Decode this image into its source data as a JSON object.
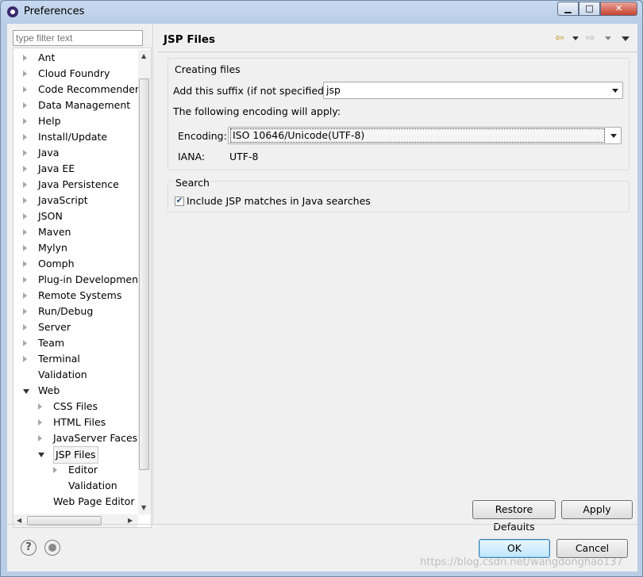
{
  "window": {
    "title": "Preferences",
    "min_symbol": "▁",
    "max_symbol": "□",
    "close_symbol": "✕"
  },
  "filter": {
    "placeholder": "type filter text"
  },
  "tree": [
    {
      "label": "Ant",
      "depth": 0,
      "state": "closed"
    },
    {
      "label": "Cloud Foundry",
      "depth": 0,
      "state": "closed"
    },
    {
      "label": "Code Recommenders",
      "depth": 0,
      "state": "closed"
    },
    {
      "label": "Data Management",
      "depth": 0,
      "state": "closed"
    },
    {
      "label": "Help",
      "depth": 0,
      "state": "closed"
    },
    {
      "label": "Install/Update",
      "depth": 0,
      "state": "closed"
    },
    {
      "label": "Java",
      "depth": 0,
      "state": "closed"
    },
    {
      "label": "Java EE",
      "depth": 0,
      "state": "closed"
    },
    {
      "label": "Java Persistence",
      "depth": 0,
      "state": "closed"
    },
    {
      "label": "JavaScript",
      "depth": 0,
      "state": "closed"
    },
    {
      "label": "JSON",
      "depth": 0,
      "state": "closed"
    },
    {
      "label": "Maven",
      "depth": 0,
      "state": "closed"
    },
    {
      "label": "Mylyn",
      "depth": 0,
      "state": "closed"
    },
    {
      "label": "Oomph",
      "depth": 0,
      "state": "closed"
    },
    {
      "label": "Plug-in Development",
      "depth": 0,
      "state": "closed"
    },
    {
      "label": "Remote Systems",
      "depth": 0,
      "state": "closed"
    },
    {
      "label": "Run/Debug",
      "depth": 0,
      "state": "closed"
    },
    {
      "label": "Server",
      "depth": 0,
      "state": "closed"
    },
    {
      "label": "Team",
      "depth": 0,
      "state": "closed"
    },
    {
      "label": "Terminal",
      "depth": 0,
      "state": "closed"
    },
    {
      "label": "Validation",
      "depth": 0,
      "state": "leaf"
    },
    {
      "label": "Web",
      "depth": 0,
      "state": "open"
    },
    {
      "label": "CSS Files",
      "depth": 1,
      "state": "closed"
    },
    {
      "label": "HTML Files",
      "depth": 1,
      "state": "closed"
    },
    {
      "label": "JavaServer Faces T",
      "depth": 1,
      "state": "closed"
    },
    {
      "label": "JSP Files",
      "depth": 1,
      "state": "open",
      "selected": true
    },
    {
      "label": "Editor",
      "depth": 2,
      "state": "closed"
    },
    {
      "label": "Validation",
      "depth": 2,
      "state": "leaf"
    },
    {
      "label": "Web Page Editor",
      "depth": 1,
      "state": "leaf"
    }
  ],
  "page": {
    "title": "JSP Files",
    "back_icon": "⇦",
    "forward_icon": "⇨",
    "creating_group": "Creating files",
    "suffix_label": "Add this suffix (if not specified):",
    "suffix_value": "jsp",
    "encoding_note": "The following encoding will apply:",
    "encoding_label": "Encoding:",
    "encoding_value": "ISO 10646/Unicode(UTF-8)",
    "iana_label": "IANA:",
    "iana_value": "UTF-8",
    "search_group": "Search",
    "search_checkbox": "Include JSP matches in Java searches",
    "search_checked": true
  },
  "buttons": {
    "restore_defaults": "Restore Defaults",
    "apply": "Apply",
    "ok": "OK",
    "cancel": "Cancel"
  },
  "footer": {
    "help_symbol": "?",
    "watermark": "https://blog.csdn.net/wangdonghao137"
  }
}
